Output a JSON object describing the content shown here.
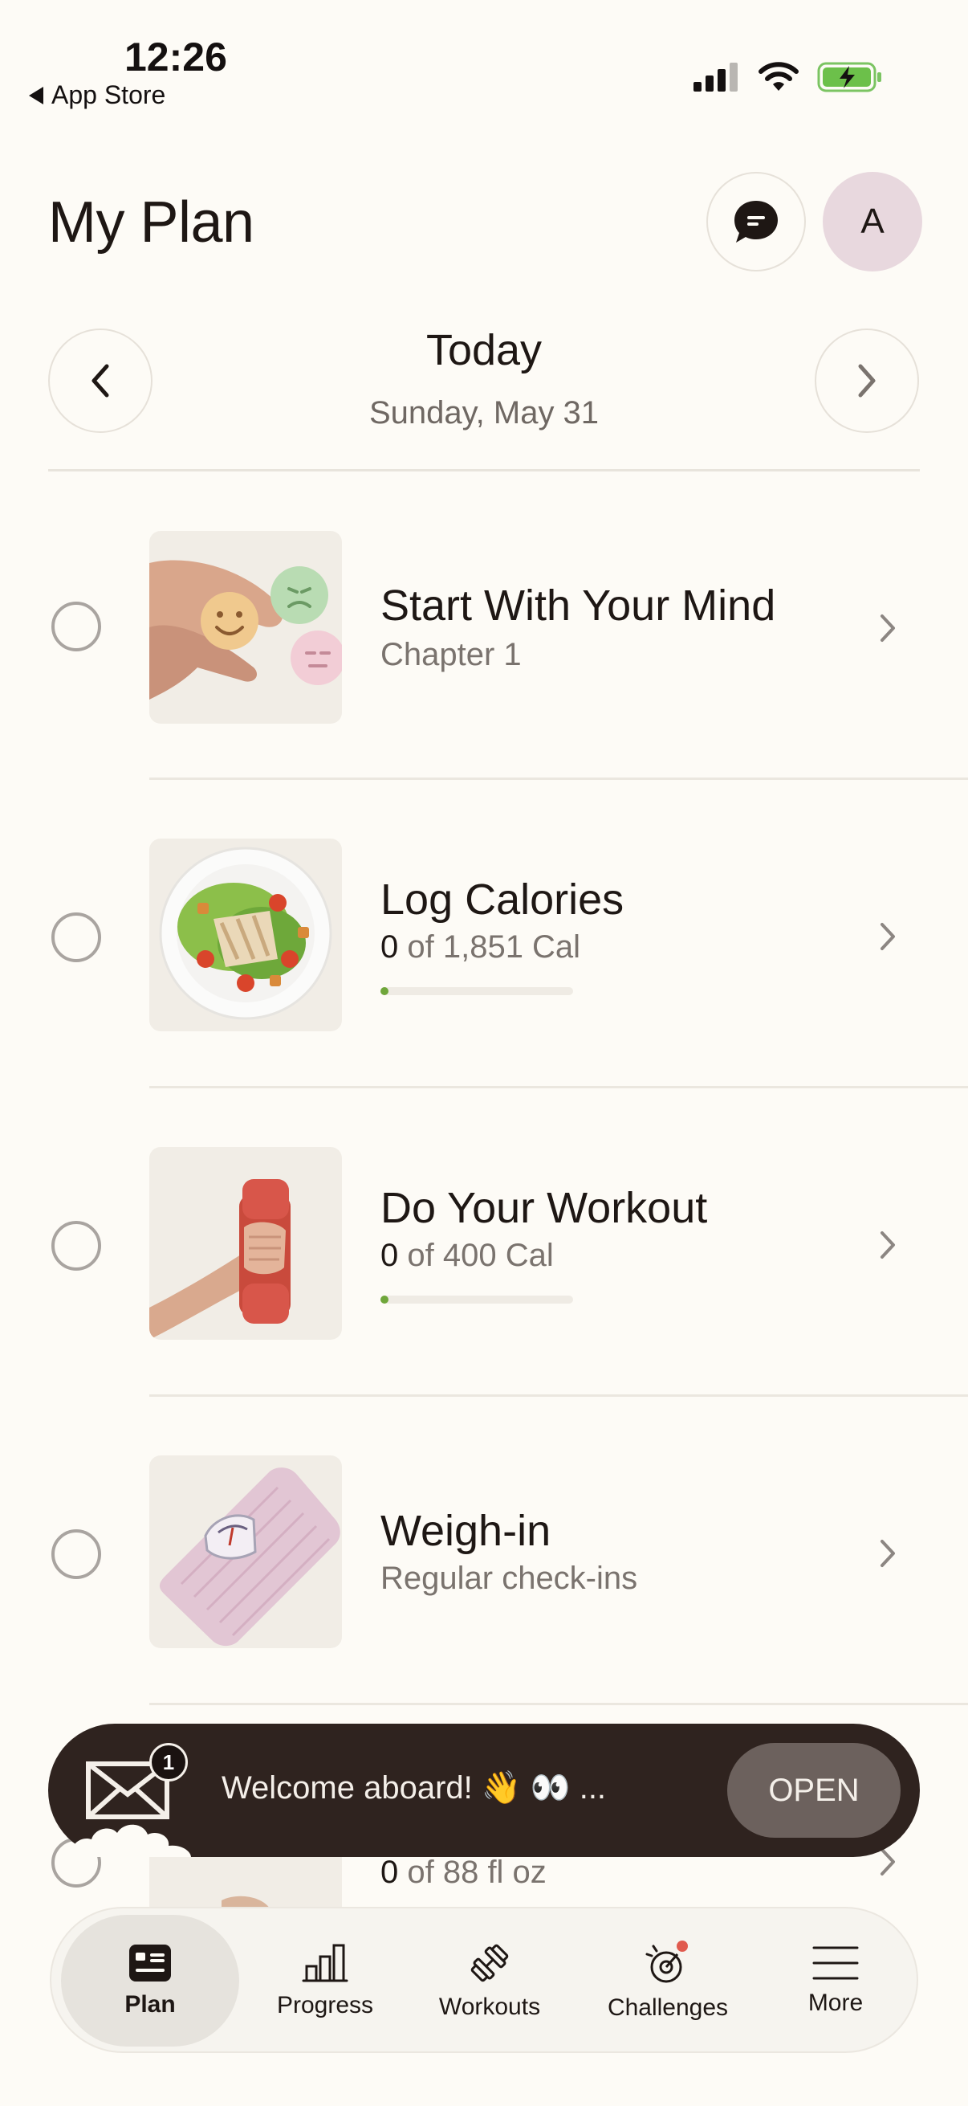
{
  "status_bar": {
    "time": "12:26",
    "back_label": "App Store"
  },
  "header": {
    "title": "My Plan",
    "chat_icon": "chat-bubble-icon",
    "avatar_initial": "A"
  },
  "date_nav": {
    "title": "Today",
    "subtitle": "Sunday, May 31"
  },
  "plan_items": [
    {
      "title": "Start With Your Mind",
      "subtitle": "Chapter 1",
      "thumb": "mind-illustration"
    },
    {
      "title": "Log Calories",
      "value": "0",
      "subtitle_rest": " of 1,851 Cal",
      "progress": 0,
      "thumb": "salad-illustration"
    },
    {
      "title": "Do Your Workout",
      "value": "0",
      "subtitle_rest": " of 400 Cal",
      "progress": 0,
      "thumb": "dumbbell-illustration"
    },
    {
      "title": "Weigh-in",
      "subtitle": "Regular check-ins",
      "thumb": "scale-illustration"
    },
    {
      "value": "0",
      "subtitle_rest": " of 88 fl oz",
      "thumb": "water-illustration"
    }
  ],
  "toast": {
    "message": "Welcome aboard! 👋 👀 ...",
    "badge_count": "1",
    "button_label": "OPEN"
  },
  "tabs": [
    {
      "label": "Plan",
      "active": true,
      "icon": "plan-icon"
    },
    {
      "label": "Progress",
      "active": false,
      "icon": "progress-icon"
    },
    {
      "label": "Workouts",
      "active": false,
      "icon": "dumbbell-icon"
    },
    {
      "label": "Challenges",
      "active": false,
      "icon": "challenges-icon"
    },
    {
      "label": "More",
      "active": false,
      "icon": "menu-icon"
    }
  ],
  "colors": {
    "background": "#fdfbf6",
    "text": "#1e1714",
    "progress_accent": "#6fa63a",
    "toast_bg": "#2f231f",
    "notification_dot": "#e05a4e"
  }
}
